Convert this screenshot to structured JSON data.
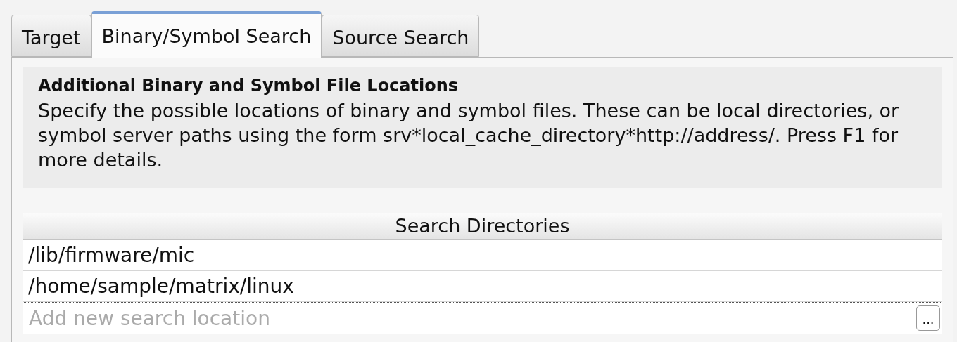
{
  "tabs": [
    {
      "label": "Target",
      "selected": false
    },
    {
      "label": "Binary/Symbol Search",
      "selected": true
    },
    {
      "label": "Source Search",
      "selected": false
    }
  ],
  "info": {
    "title": "Additional Binary and Symbol File Locations",
    "text": "Specify the possible locations of binary and symbol files. These can be local directories, or symbol server paths using the form srv*local_cache_directory*http://address/. Press F1 for more details."
  },
  "table": {
    "columns": [
      "Search Directories"
    ],
    "rows": [
      "/lib/firmware/mic",
      "/home/sample/matrix/linux"
    ],
    "new_row": {
      "placeholder": "Add new search location",
      "button": "..."
    }
  }
}
